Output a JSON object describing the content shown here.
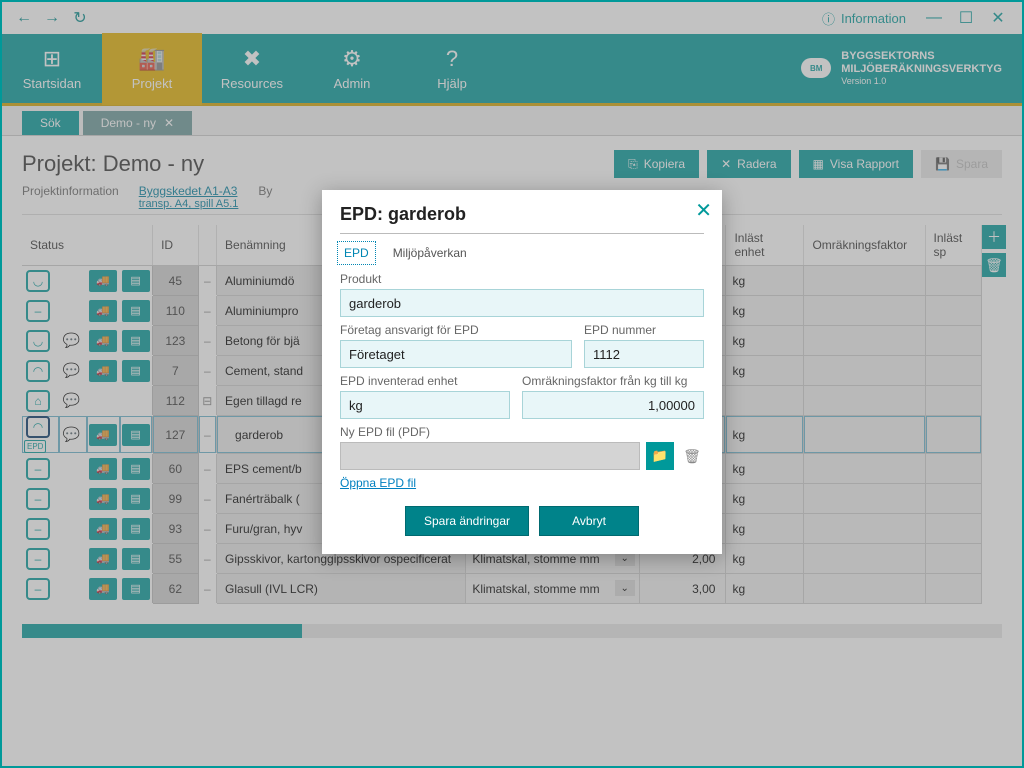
{
  "titlebar": {
    "info_label": "Information"
  },
  "ribbon": {
    "items": [
      "Startsidan",
      "Projekt",
      "Resources",
      "Admin",
      "Hjälp"
    ],
    "brand_line1": "BYGGSEKTORNS",
    "brand_line2": "MILJÖBERÄKNINGSVERKTYG",
    "brand_line3": "Version 1.0",
    "brand_badge": "BM"
  },
  "tabs": {
    "search": "Sök",
    "project": "Demo - ny"
  },
  "page": {
    "title": "Projekt: Demo - ny",
    "actions": {
      "copy": "Kopiera",
      "delete": "Radera",
      "report": "Visa Rapport",
      "save": "Spara"
    },
    "subtabs": {
      "info": "Projektinformation",
      "bygg": "Byggskedet A1-A3",
      "bygg_sub": "transp. A4, spill A5.1",
      "byggplats": "By"
    }
  },
  "columns": {
    "status": "Status",
    "id": "ID",
    "name": "Benämning",
    "cat": "",
    "qty": "",
    "unit": "Inläst enhet",
    "factor": "Omräkningsfaktor",
    "spill": "Inläst sp"
  },
  "rows": [
    {
      "face": "smile",
      "comment": false,
      "epd": false,
      "truck": true,
      "id": "45",
      "name": "Aluminiumdö",
      "cat": "",
      "qty": "",
      "unit": "kg"
    },
    {
      "face": "neutral",
      "comment": false,
      "epd": false,
      "truck": true,
      "id": "110",
      "name": "Aluminiumpro",
      "cat": "",
      "qty": "",
      "unit": "kg"
    },
    {
      "face": "smile",
      "comment": true,
      "epd": false,
      "truck": true,
      "id": "123",
      "name": "Betong för bjä",
      "cat": "",
      "qty": "",
      "unit": "kg"
    },
    {
      "face": "sad",
      "comment": true,
      "epd": false,
      "truck": true,
      "id": "7",
      "name": "Cement, stand",
      "cat": "",
      "qty": "",
      "unit": "kg"
    },
    {
      "face": "home",
      "comment": true,
      "epd": false,
      "truck": false,
      "id": "112",
      "name": "Egen tillagd re",
      "cat": "",
      "qty": "",
      "unit": "",
      "expand": "⊟"
    },
    {
      "face": "sad",
      "comment": true,
      "epd": true,
      "truck": true,
      "id": "127",
      "name": "garderob",
      "cat": "",
      "qty": "",
      "unit": "kg",
      "selected": true,
      "sub": true
    },
    {
      "face": "neutral",
      "comment": false,
      "epd": false,
      "truck": true,
      "id": "60",
      "name": "EPS cement/b",
      "cat": "",
      "qty": "",
      "unit": "kg"
    },
    {
      "face": "neutral",
      "comment": false,
      "epd": false,
      "truck": true,
      "id": "99",
      "name": "Fanérträbalk (",
      "cat": "",
      "qty": "",
      "unit": "kg"
    },
    {
      "face": "neutral",
      "comment": false,
      "epd": false,
      "truck": true,
      "id": "93",
      "name": "Furu/gran, hyv",
      "cat": "",
      "qty": "",
      "unit": "kg"
    },
    {
      "face": "neutral",
      "comment": false,
      "epd": false,
      "truck": true,
      "id": "55",
      "name": "Gipsskivor, kartonggipsskivor ospecificerat",
      "cat": "Klimatskal, stomme mm",
      "qty": "2,00",
      "unit": "kg"
    },
    {
      "face": "neutral",
      "comment": false,
      "epd": false,
      "truck": true,
      "id": "62",
      "name": "Glasull (IVL LCR)",
      "cat": "Klimatskal, stomme mm",
      "qty": "3,00",
      "unit": "kg"
    }
  ],
  "modal": {
    "title": "EPD: garderob",
    "tabs": {
      "epd": "EPD",
      "impact": "Miljöpåverkan"
    },
    "labels": {
      "product": "Produkt",
      "company": "Företag ansvarigt för EPD",
      "epdnum": "EPD nummer",
      "unit": "EPD inventerad enhet",
      "factor": "Omräkningsfaktor från kg till kg",
      "file": "Ny EPD fil (PDF)"
    },
    "values": {
      "product": "garderob",
      "company": "Företaget",
      "epdnum": "1112",
      "unit": "kg",
      "factor": "1,00000"
    },
    "link": "Öppna EPD fil",
    "save": "Spara ändringar",
    "cancel": "Avbryt"
  }
}
